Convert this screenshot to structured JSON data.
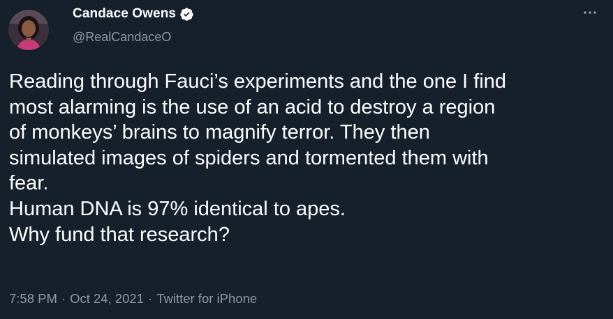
{
  "author": {
    "display_name": "Candace Owens",
    "handle": "@RealCandaceO",
    "verified": true,
    "avatar_icon": "profile-photo-icon"
  },
  "menu": {
    "icon": "more-options-icon"
  },
  "tweet": {
    "lines": [
      "Reading through Fauci’s experiments and the one I find",
      "most alarming is the use of an acid to destroy a region",
      "of monkeys’ brains to magnify terror. They then",
      "simulated images of spiders and tormented them with",
      "fear.",
      "Human DNA is 97% identical to apes.",
      "Why fund that research?"
    ]
  },
  "meta": {
    "time": "7:58 PM",
    "separator": "·",
    "date": "Oct 24, 2021",
    "source": "Twitter for iPhone"
  },
  "colors": {
    "background": "#15202b",
    "text_primary": "#ffffff",
    "text_secondary": "#8b98a5",
    "verified_badge": "#ffffff"
  }
}
